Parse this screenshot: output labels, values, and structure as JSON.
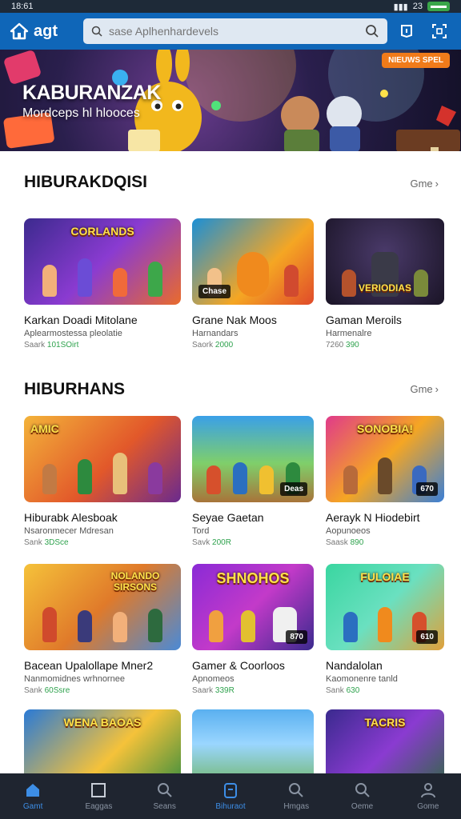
{
  "status_bar": {
    "time": "18:61",
    "signal": "23",
    "battery": ""
  },
  "header": {
    "logo_text": "agt",
    "search_placeholder": "sase Aplhenhardevels"
  },
  "hero": {
    "title": "KABURANZAK",
    "subtitle": "Mordceps hl hlooces",
    "badge": "NIEUWS SPEL"
  },
  "sections": [
    {
      "title": "HIBURAKDQISI",
      "more_label": "Gme",
      "cards": [
        {
          "title": "Karkan Doadi Mitolane",
          "subtitle": "Aplearmostessa pleolatie",
          "meta_prefix": "Saark",
          "meta_value": "101SOirt",
          "banner": "CORLANDS",
          "tag": ""
        },
        {
          "title": "Grane Nak  Moos",
          "subtitle": "Harnandars",
          "meta_prefix": "Saork",
          "meta_value": "2000",
          "banner": "",
          "tag": "Chase"
        },
        {
          "title": "Gaman Meroils",
          "subtitle": "Harmenalre",
          "meta_prefix": "7260",
          "meta_value": "390",
          "banner": "VERIODIAS",
          "tag": ""
        }
      ]
    },
    {
      "title": "HIBURHANS",
      "more_label": "Gme",
      "cards": [
        {
          "title": "Hiburabk Alesboak",
          "subtitle": "Nsaronmecer Mdresan",
          "meta_prefix": "Sank",
          "meta_value": "3DSce",
          "banner": "AMIC",
          "tag": ""
        },
        {
          "title": "Seyae Gaetan",
          "subtitle": "Tord",
          "meta_prefix": "Savk",
          "meta_value": "200R",
          "banner": "",
          "tag": "Deas"
        },
        {
          "title": "Aerayk N Hiodebirt",
          "subtitle": "Aopunoeos",
          "meta_prefix": "Saask",
          "meta_value": "890",
          "banner": "SONOBIA!",
          "tag": "670"
        }
      ]
    },
    {
      "title": "",
      "more_label": "",
      "cards": [
        {
          "title": "Bacean Upalollape Mner2",
          "subtitle": "Nanmomidnes wrhnornee",
          "meta_prefix": "Sank",
          "meta_value": "60Ssre",
          "banner": "NOLANDO SIRSONS",
          "tag": ""
        },
        {
          "title": "Gamer & Coorloos",
          "subtitle": "Apnomeos",
          "meta_prefix": "Saark",
          "meta_value": "339R",
          "banner": "SHNOHOS",
          "tag": "870"
        },
        {
          "title": "Nandalolan",
          "subtitle": "Kaomonenre tanld",
          "meta_prefix": "Sank",
          "meta_value": "630",
          "banner": "FULOIAE",
          "tag": "610"
        }
      ]
    },
    {
      "title": "",
      "more_label": "",
      "cards": [
        {
          "title": "",
          "subtitle": "",
          "meta_prefix": "",
          "meta_value": "",
          "banner": "WENA BAOAS",
          "tag": ""
        },
        {
          "title": "",
          "subtitle": "",
          "meta_prefix": "",
          "meta_value": "",
          "banner": "",
          "tag": ""
        },
        {
          "title": "",
          "subtitle": "",
          "meta_prefix": "",
          "meta_value": "",
          "banner": "TACRIS",
          "tag": ""
        }
      ]
    }
  ],
  "bottom_nav": [
    {
      "label": "Gamt",
      "icon": "home-icon",
      "active": true
    },
    {
      "label": "Eaggas",
      "icon": "square-icon",
      "active": false
    },
    {
      "label": "Seans",
      "icon": "search-icon",
      "active": false
    },
    {
      "label": "Bihuraot",
      "icon": "clipboard-icon",
      "active": true
    },
    {
      "label": "Hmgas",
      "icon": "search-icon",
      "active": false
    },
    {
      "label": "Oeme",
      "icon": "search-icon",
      "active": false
    },
    {
      "label": "Gome",
      "icon": "profile-icon",
      "active": false
    }
  ],
  "colors": {
    "header_bg": "#0f66b8",
    "accent": "#3d8ee6",
    "meta_green": "#2ea24d",
    "nav_bg": "#1f2530"
  }
}
